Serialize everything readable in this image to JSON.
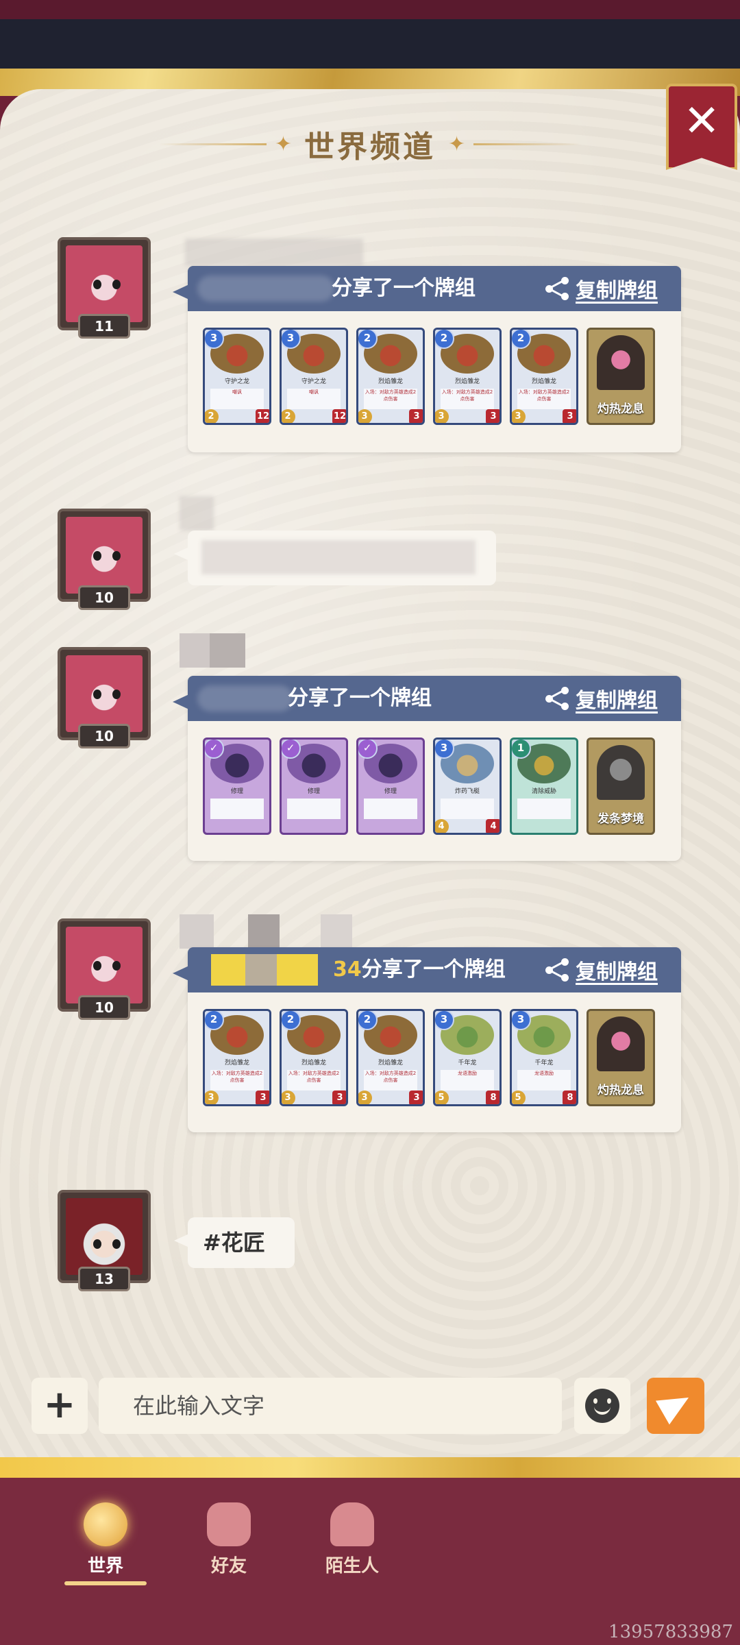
{
  "channel": {
    "title": "世界频道"
  },
  "messages": [
    {
      "level": "11",
      "shared_text": "分享了一个牌组",
      "copy_label": "复制牌组",
      "cards": [
        {
          "cost": "3",
          "name": "守护之龙",
          "text": "嘲讽",
          "atk": "2",
          "hp": "12"
        },
        {
          "cost": "3",
          "name": "守护之龙",
          "text": "嘲讽",
          "atk": "2",
          "hp": "12"
        },
        {
          "cost": "2",
          "name": "烈焰雏龙",
          "text": "入场：对敌方英雄造成2点伤害",
          "atk": "3",
          "hp": "3"
        },
        {
          "cost": "2",
          "name": "烈焰雏龙",
          "text": "入场：对敌方英雄造成2点伤害",
          "atk": "3",
          "hp": "3"
        },
        {
          "cost": "2",
          "name": "烈焰雏龙",
          "text": "入场：对敌方英雄造成2点伤害",
          "atk": "3",
          "hp": "3"
        }
      ],
      "hero": "灼热龙息"
    },
    {
      "level": "10"
    },
    {
      "level": "10",
      "shared_text": "分享了一个牌组",
      "copy_label": "复制牌组",
      "cards": [
        {
          "cost": "✓",
          "name": "修理",
          "text": "",
          "atk": "",
          "hp": ""
        },
        {
          "cost": "✓",
          "name": "修理",
          "text": "",
          "atk": "",
          "hp": ""
        },
        {
          "cost": "✓",
          "name": "修理",
          "text": "",
          "atk": "",
          "hp": ""
        },
        {
          "cost": "3",
          "name": "炸药飞艇",
          "text": "",
          "atk": "4",
          "hp": "4"
        },
        {
          "cost": "1",
          "name": "清除威胁",
          "text": "",
          "atk": "",
          "hp": ""
        }
      ],
      "hero": "发条梦境"
    },
    {
      "level": "10",
      "name_suffix": "34",
      "shared_text": "分享了一个牌组",
      "copy_label": "复制牌组",
      "cards": [
        {
          "cost": "2",
          "name": "烈焰雏龙",
          "text": "入场：对敌方英雄造成2点伤害",
          "atk": "3",
          "hp": "3"
        },
        {
          "cost": "2",
          "name": "烈焰雏龙",
          "text": "入场：对敌方英雄造成2点伤害",
          "atk": "3",
          "hp": "3"
        },
        {
          "cost": "2",
          "name": "烈焰雏龙",
          "text": "入场：对敌方英雄造成2点伤害",
          "atk": "3",
          "hp": "3"
        },
        {
          "cost": "3",
          "name": "千年龙",
          "text": "龙语激励",
          "atk": "5",
          "hp": "8"
        },
        {
          "cost": "3",
          "name": "千年龙",
          "text": "龙语激励",
          "atk": "5",
          "hp": "8"
        }
      ],
      "hero": "灼热龙息"
    },
    {
      "level": "13",
      "text": "#花匠"
    }
  ],
  "input": {
    "placeholder": "在此输入文字"
  },
  "tabs": [
    {
      "label": "世界",
      "active": true
    },
    {
      "label": "好友",
      "active": false
    },
    {
      "label": "陌生人",
      "active": false
    }
  ],
  "watermark": "13957833987",
  "colors": {
    "header_blue": "#55678f",
    "send_orange": "#f08a2d",
    "tabbar_bg": "#7a2b3f"
  },
  "icons": [
    "close-icon",
    "share-icon",
    "plus-icon",
    "emoji-icon",
    "send-icon",
    "globe-icon",
    "handshake-icon",
    "stranger-icon"
  ]
}
